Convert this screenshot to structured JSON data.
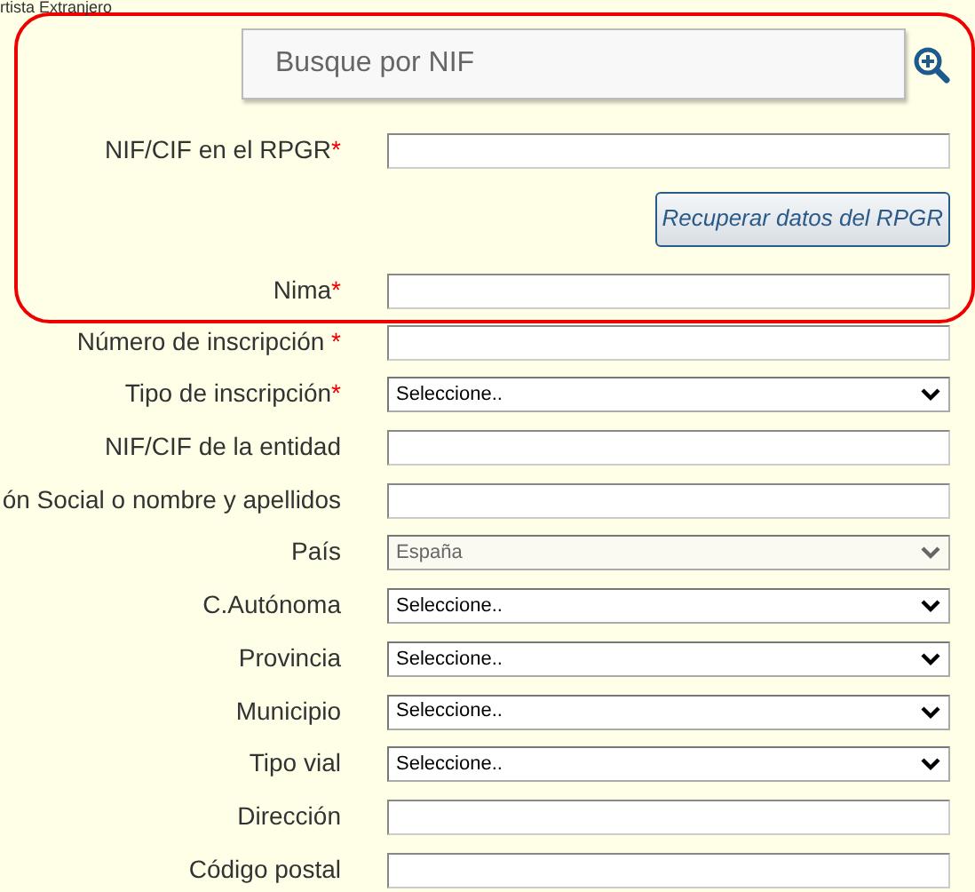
{
  "top_text": "rtista Extranjero",
  "lookup_box": {
    "search": {
      "placeholder": "Busque por NIF"
    },
    "fields": [
      {
        "label": "NIF/CIF en el RPGR",
        "required_mark": "*",
        "kind": "text"
      }
    ],
    "button": "Recuperar datos del RPGR",
    "fields_after": [
      {
        "label": "Nima",
        "required_mark": "*",
        "kind": "text"
      }
    ]
  },
  "fields": [
    {
      "label": "Número de inscripción ",
      "required_mark": "*",
      "kind": "text"
    },
    {
      "label": "Tipo de inscripción",
      "required_mark": "*",
      "kind": "select",
      "value": "Seleccione..",
      "disabled": false
    },
    {
      "label": "NIF/CIF de la entidad",
      "kind": "text"
    },
    {
      "label": "ón Social o nombre y apellidos",
      "kind": "text"
    },
    {
      "label": "País",
      "kind": "select",
      "value": "España",
      "disabled": true
    },
    {
      "label": "C.Autónoma",
      "kind": "select",
      "value": "Seleccione..",
      "disabled": false
    },
    {
      "label": "Provincia",
      "kind": "select",
      "value": "Seleccione..",
      "disabled": false
    },
    {
      "label": "Municipio",
      "kind": "select",
      "value": "Seleccione..",
      "disabled": false
    },
    {
      "label": "Tipo vial",
      "kind": "select",
      "value": "Seleccione..",
      "disabled": false
    },
    {
      "label": "Dirección",
      "kind": "text"
    },
    {
      "label": "Código postal",
      "kind": "text"
    }
  ]
}
